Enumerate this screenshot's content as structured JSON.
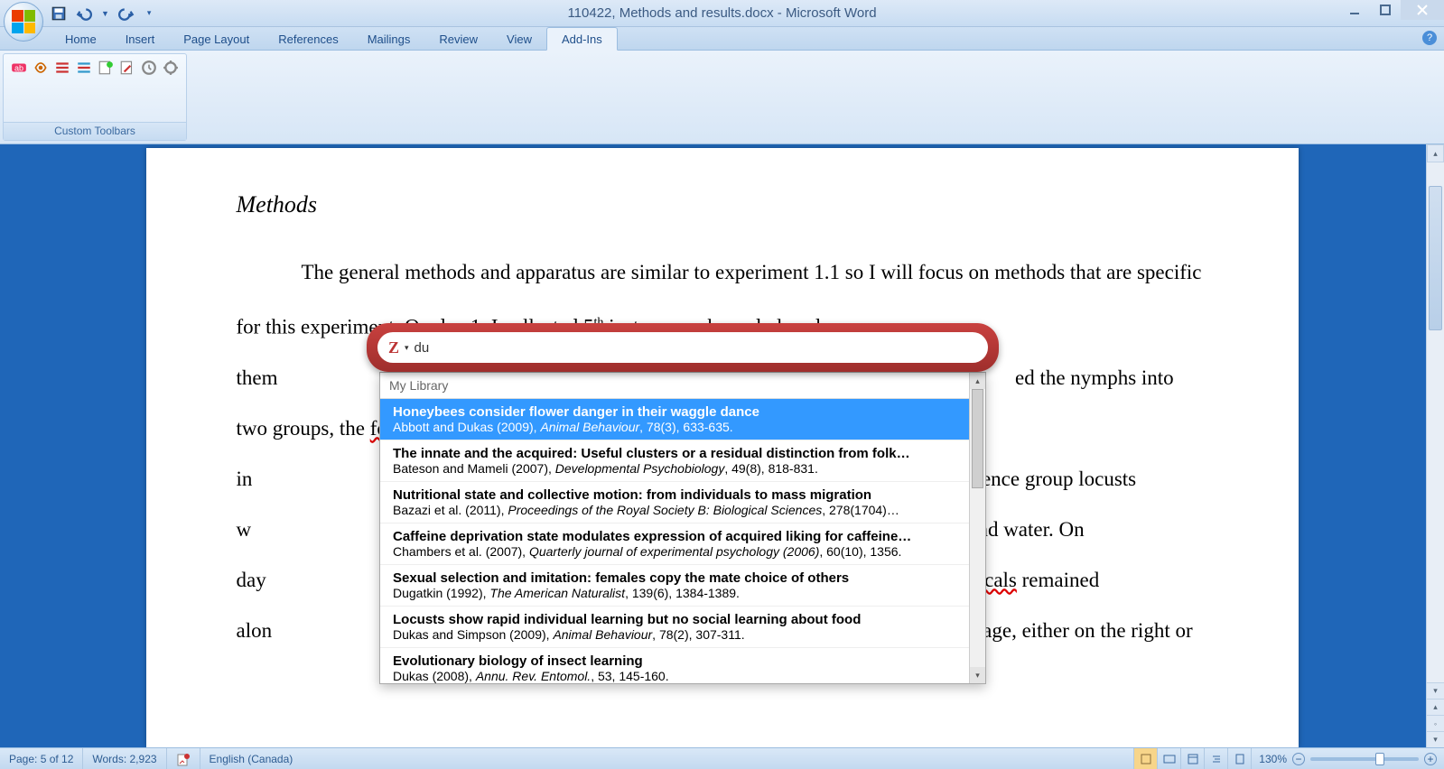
{
  "title": "110422, Methods and results.docx - Microsoft Word",
  "tabs": [
    "Home",
    "Insert",
    "Page Layout",
    "References",
    "Mailings",
    "Review",
    "View",
    "Add-Ins"
  ],
  "active_tab": "Add-Ins",
  "ribbon_group_label": "Custom Toolbars",
  "document": {
    "heading": "Methods",
    "para": "The general methods and apparatus are similar to experiment 1.1 so I will focus on methods that are specific for this experiment. On day 1, I collected 5th instar nymphs and placed them                                                                                                                                   ed the nymphs into two groups, the focals [Citation] and the influence group. I placed the focals individually in                                                                                                                          fluence group locusts w                                                                                                                          der and water. On day                                                                                                                     0 focals remained alon                                                                                                              e each cage, either on the right or"
  },
  "zotero": {
    "query": "du",
    "library_label": "My Library",
    "items": [
      {
        "title": "Honeybees consider flower danger in their waggle dance",
        "authors": "Abbott and Dukas (2009)",
        "journal": "Animal Behaviour",
        "loc": "78(3), 633-635."
      },
      {
        "title": "The innate and the acquired: Useful clusters or a residual distinction from folk…",
        "authors": "Bateson and Mameli (2007)",
        "journal": "Developmental Psychobiology",
        "loc": "49(8), 818-831."
      },
      {
        "title": "Nutritional state and collective motion: from individuals to mass migration",
        "authors": "Bazazi et al. (2011)",
        "journal": "Proceedings of the Royal Society B: Biological Sciences",
        "loc": "278(1704)…"
      },
      {
        "title": "Caffeine deprivation state modulates expression of acquired liking for caffeine…",
        "authors": "Chambers et al. (2007)",
        "journal": "Quarterly journal of experimental psychology (2006)",
        "loc": "60(10), 1356."
      },
      {
        "title": "Sexual selection and imitation: females copy the mate choice of others",
        "authors": "Dugatkin (1992)",
        "journal": "The American Naturalist",
        "loc": "139(6), 1384-1389."
      },
      {
        "title": "Locusts show rapid individual learning but no social learning about food",
        "authors": "Dukas and Simpson (2009)",
        "journal": "Animal Behaviour",
        "loc": "78(2), 307-311."
      },
      {
        "title": "Evolutionary biology of insect learning",
        "authors": "Dukas (2008)",
        "journal": "Annu. Rev. Entomol.",
        "loc": "53, 145-160."
      }
    ]
  },
  "status": {
    "page": "Page: 5 of 12",
    "words": "Words: 2,923",
    "lang": "English (Canada)",
    "zoom": "130%"
  }
}
